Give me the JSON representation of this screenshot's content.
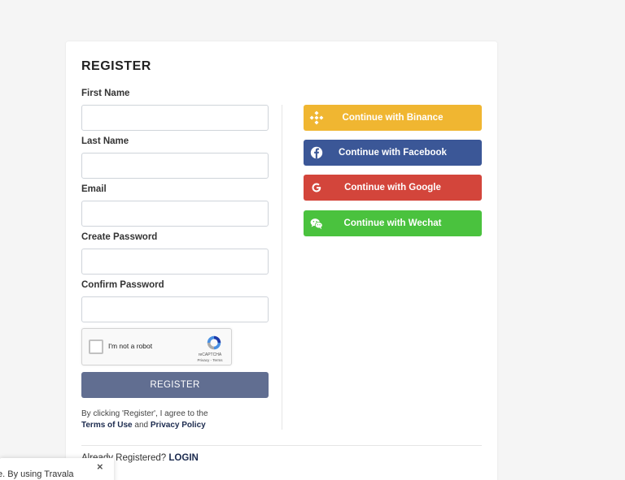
{
  "form": {
    "title": "REGISTER",
    "fields": [
      {
        "label": "First Name",
        "value": "",
        "placeholder": ""
      },
      {
        "label": "Last Name",
        "value": "",
        "placeholder": ""
      },
      {
        "label": "Email",
        "value": "",
        "placeholder": ""
      },
      {
        "label": "Create Password",
        "value": "",
        "placeholder": ""
      },
      {
        "label": "Confirm Password",
        "value": "",
        "placeholder": ""
      }
    ],
    "captcha": {
      "label": "I'm not a robot",
      "brand": "reCAPTCHA",
      "links": "Privacy - Terms"
    },
    "submit_label": "REGISTER",
    "terms_prefix": "By clicking 'Register', I agree to the",
    "terms_link": "Terms of Use",
    "terms_and": "and",
    "privacy_link": "Privacy Policy"
  },
  "social": [
    {
      "label": "Continue with Binance",
      "icon": "binance-icon",
      "color": "#f0b631"
    },
    {
      "label": "Continue with Facebook",
      "icon": "facebook-icon",
      "color": "#3b5797"
    },
    {
      "label": "Continue with Google",
      "icon": "google-icon",
      "color": "#d3453b"
    },
    {
      "label": "Continue with Wechat",
      "icon": "wechat-icon",
      "color": "#4ac23e"
    }
  ],
  "login": {
    "prompt": "Already Registered?",
    "link": "LOGIN"
  },
  "cookie": {
    "text": "e. By using Travala",
    "close": "×"
  }
}
